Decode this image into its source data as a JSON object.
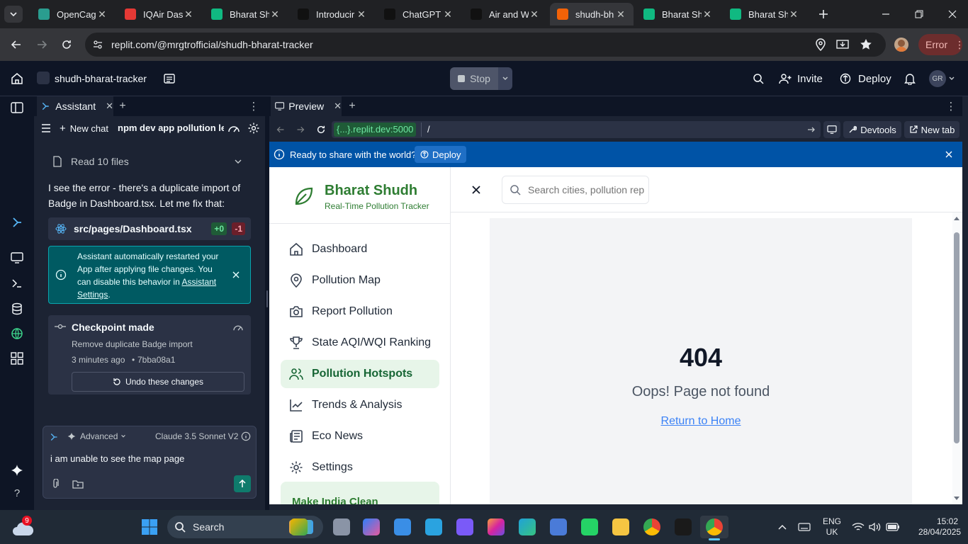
{
  "browser": {
    "tabs": [
      {
        "title": "OpenCag",
        "icon": "opencage-icon",
        "color": "#2a9d8f"
      },
      {
        "title": "IQAir Das",
        "icon": "iqair-icon",
        "color": "#e53935"
      },
      {
        "title": "Bharat Sh",
        "icon": "replit-app-icon",
        "color": "#10b981"
      },
      {
        "title": "Introducir",
        "icon": "openai-icon",
        "color": "#111111"
      },
      {
        "title": "ChatGPT",
        "icon": "openai-icon",
        "color": "#111111"
      },
      {
        "title": "Air and W",
        "icon": "openai-icon",
        "color": "#111111"
      },
      {
        "title": "shudh-bh",
        "icon": "replit-icon",
        "color": "#f26207"
      },
      {
        "title": "Bharat Sh",
        "icon": "replit-app-icon",
        "color": "#10b981"
      },
      {
        "title": "Bharat Sh",
        "icon": "replit-app-icon",
        "color": "#10b981"
      }
    ],
    "active_tab": 6,
    "url": "replit.com/@mrgtrofficial/shudh-bharat-tracker",
    "error_label": "Error"
  },
  "replit": {
    "project_name": "shudh-bharat-tracker",
    "stop_label": "Stop",
    "invite_label": "Invite",
    "deploy_label": "Deploy",
    "avatar_initials": "GR"
  },
  "assistant": {
    "tab_label": "Assistant",
    "new_chat_label": "New chat",
    "chat_title": "npm dev app pollution le...",
    "read_files_label": "Read 10 files",
    "message": "I see the error - there's a duplicate import of Badge in Dashboard.tsx. Let me fix that:",
    "file_name": "src/pages/Dashboard.tsx",
    "additions": "+0",
    "deletions": "-1",
    "info_text": "Assistant automatically restarted your App after applying file changes. You can disable this behavior in",
    "info_link": "Assistant Settings",
    "info_period": ".",
    "checkpoint_title": "Checkpoint made",
    "checkpoint_desc": "Remove duplicate Badge import",
    "checkpoint_time": "3 minutes ago",
    "checkpoint_hash": "7bba08a1",
    "undo_label": "Undo these changes",
    "advanced_label": "Advanced",
    "model_label": "Claude 3.5 Sonnet V2",
    "input_value": "i am unable to see the map page"
  },
  "preview": {
    "tab_label": "Preview",
    "url_host": "{...}.replit.dev:5000",
    "url_path": "/",
    "devtools_label": "Devtools",
    "newtab_label": "New tab",
    "banner_text": "Ready to share with the world?",
    "banner_deploy": "Deploy"
  },
  "app": {
    "brand": "Bharat Shudh",
    "tagline": "Real-Time Pollution Tracker",
    "search_placeholder": "Search cities, pollution rep",
    "nav": [
      {
        "label": "Dashboard",
        "icon": "home-icon"
      },
      {
        "label": "Pollution Map",
        "icon": "map-pin-icon"
      },
      {
        "label": "Report Pollution",
        "icon": "camera-icon"
      },
      {
        "label": "State AQI/WQI Ranking",
        "icon": "trophy-icon"
      },
      {
        "label": "Pollution Hotspots",
        "icon": "users-icon"
      },
      {
        "label": "Trends & Analysis",
        "icon": "trend-icon"
      },
      {
        "label": "Eco News",
        "icon": "newspaper-icon"
      },
      {
        "label": "Settings",
        "icon": "gear-icon"
      }
    ],
    "active_nav": 4,
    "promo_label": "Make India Clean",
    "error_code": "404",
    "error_message": "Oops! Page not found",
    "return_link": "Return to Home"
  },
  "taskbar": {
    "search_label": "Search",
    "weather_badge": "9",
    "lang_top": "ENG",
    "lang_bottom": "UK",
    "time": "15:02",
    "date": "28/04/2025"
  }
}
